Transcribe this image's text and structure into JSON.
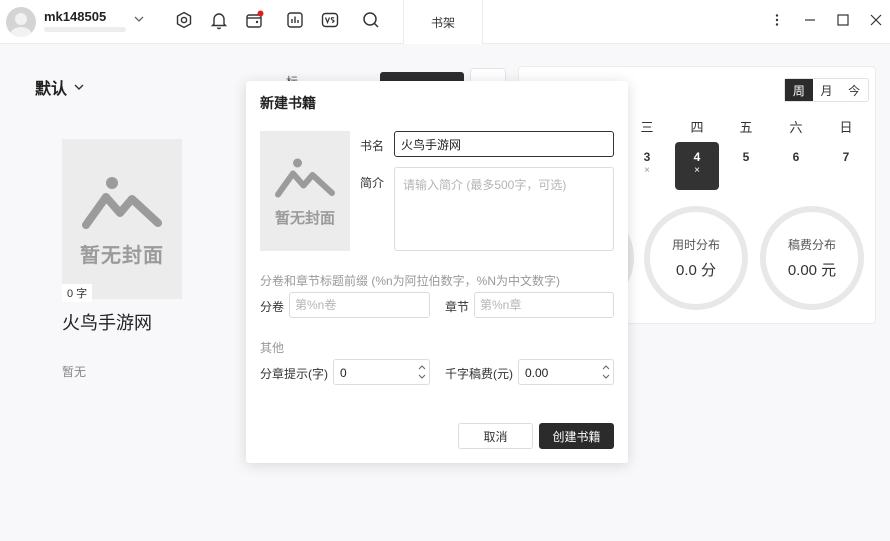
{
  "user": {
    "name": "mk148505"
  },
  "toolbar": {
    "icons": [
      "settings-hex-icon",
      "bell-icon",
      "wallet-icon",
      "chart-icon",
      "vs-icon",
      "search-icon"
    ],
    "notification_color": "#e02020"
  },
  "tabs": [
    {
      "label": "书架"
    }
  ],
  "shelf": {
    "filter_label": "默认",
    "book": {
      "cover_text": "暂无封面",
      "word_count": "0 字",
      "title": "火鸟手游网",
      "description": "暂无"
    }
  },
  "background": {
    "partial_text": "标"
  },
  "stats": {
    "period_options": [
      "周",
      "月",
      "今"
    ],
    "period_selected": "周",
    "weekdays_visible": [
      "三",
      "四",
      "五",
      "六",
      "日"
    ],
    "days": [
      {
        "num": "3",
        "mark": "×",
        "active": false
      },
      {
        "num": "4",
        "mark": "×",
        "active": true
      },
      {
        "num": "5",
        "mark": "",
        "active": false
      },
      {
        "num": "6",
        "mark": "",
        "active": false
      },
      {
        "num": "7",
        "mark": "",
        "active": false
      }
    ],
    "time_dist": {
      "label": "用时分布",
      "value": "0.0 分"
    },
    "fee_dist": {
      "label": "稿费分布",
      "value": "0.00 元"
    }
  },
  "modal": {
    "title": "新建书籍",
    "cover_text": "暂无封面",
    "name_label": "书名",
    "name_value": "火鸟手游网",
    "intro_label": "简介",
    "intro_placeholder": "请输入简介 (最多500字，可选)",
    "prefix_note": "分卷和章节标题前缀 (%n为阿拉伯数字，%N为中文数字)",
    "volume_label": "分卷",
    "volume_placeholder": "第%n卷",
    "chapter_label": "章节",
    "chapter_placeholder": "第%n章",
    "other_label": "其他",
    "chapter_hint_label": "分章提示(字)",
    "chapter_hint_value": "0",
    "fee_label": "千字稿费(元)",
    "fee_value": "0.00",
    "cancel_label": "取消",
    "create_label": "创建书籍"
  }
}
